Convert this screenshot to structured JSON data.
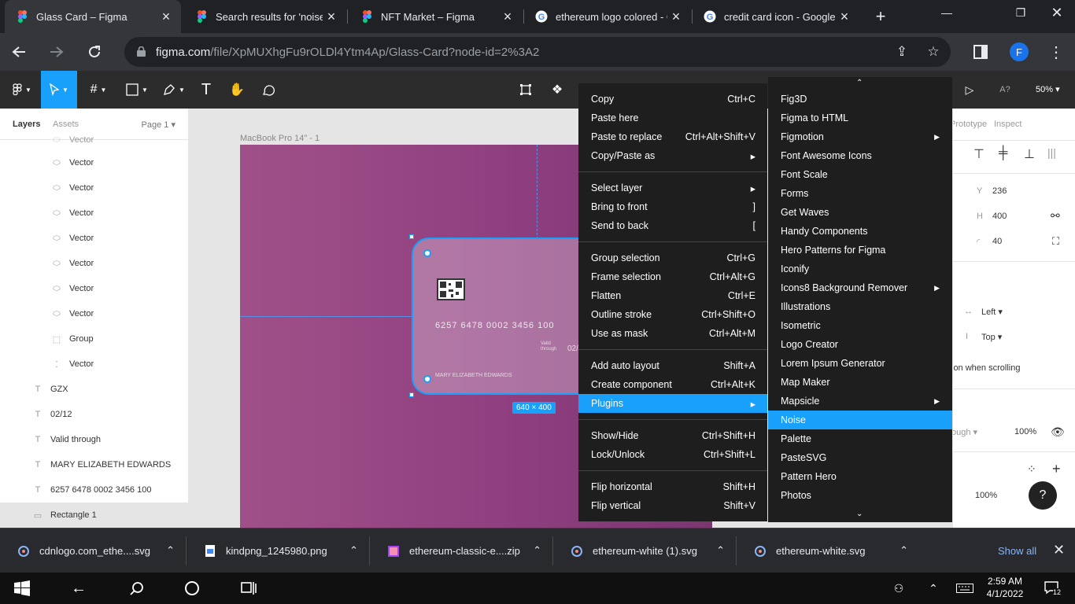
{
  "browser": {
    "tabs": [
      {
        "title": "Glass Card – Figma",
        "favicon": "figma-icon",
        "active": true
      },
      {
        "title": "Search results for 'noise' –",
        "favicon": "figma-icon",
        "active": false
      },
      {
        "title": "NFT Market – Figma",
        "favicon": "figma-icon",
        "active": false
      },
      {
        "title": "ethereum logo colored - G",
        "favicon": "google-icon",
        "active": false
      },
      {
        "title": "credit card icon - Google S",
        "favicon": "google-icon",
        "active": false
      }
    ],
    "url_host": "figma.com",
    "url_path": "/file/XpMUXhgFu9rOLDl4Ytm4Ap/Glass-Card?node-id=2%3A2",
    "profile_initial": "F"
  },
  "figma": {
    "zoom": "50%",
    "left_panel": {
      "tab_layers": "Layers",
      "tab_assets": "Assets",
      "page": "Page 1",
      "layers": [
        {
          "name": "Vector",
          "icon": "vector-icon",
          "indent": 2
        },
        {
          "name": "Vector",
          "icon": "vector-icon",
          "indent": 2
        },
        {
          "name": "Vector",
          "icon": "vector-icon",
          "indent": 2
        },
        {
          "name": "Vector",
          "icon": "vector-icon",
          "indent": 2
        },
        {
          "name": "Vector",
          "icon": "vector-icon",
          "indent": 2
        },
        {
          "name": "Vector",
          "icon": "vector-icon",
          "indent": 2
        },
        {
          "name": "Vector",
          "icon": "vector-icon",
          "indent": 2
        },
        {
          "name": "Vector",
          "icon": "vector-icon",
          "indent": 2
        },
        {
          "name": "Group",
          "icon": "group-icon",
          "indent": 2
        },
        {
          "name": "Vector",
          "icon": "vector-icon",
          "indent": 2
        },
        {
          "name": "GZX",
          "icon": "text-icon",
          "indent": 1
        },
        {
          "name": "02/12",
          "icon": "text-icon",
          "indent": 1
        },
        {
          "name": "Valid through",
          "icon": "text-icon",
          "indent": 1
        },
        {
          "name": "MARY ELIZABETH EDWARDS",
          "icon": "text-icon",
          "indent": 1
        },
        {
          "name": "6257 6478 0002 3456 100",
          "icon": "text-icon",
          "indent": 1
        },
        {
          "name": "Rectangle 1",
          "icon": "rectangle-icon",
          "indent": 1,
          "selected": true
        }
      ]
    },
    "canvas": {
      "frame_label": "MacBook Pro 14\" - 1",
      "card_number": "6257 6478 0002 3456 100",
      "card_name": "MARY ELIZABETH EDWARDS",
      "card_valid": "Valid through",
      "card_date": "02/",
      "dimensions": "640 × 400"
    },
    "right_panel": {
      "tab_prototype": "Prototype",
      "tab_inspect": "Inspect",
      "y_value": "236",
      "h_value": "400",
      "radius_value": "40",
      "constraint_h": "Left",
      "constraint_v": "Top",
      "scroll_text": "ion when scrolling",
      "blend": "ough",
      "opacity": "100%",
      "fill_opacity": "100%"
    },
    "context_menu": {
      "items": [
        {
          "label": "Copy",
          "shortcut": "Ctrl+C"
        },
        {
          "label": "Paste here",
          "shortcut": ""
        },
        {
          "label": "Paste to replace",
          "shortcut": "Ctrl+Alt+Shift+V"
        },
        {
          "label": "Copy/Paste as",
          "shortcut": "▸"
        },
        {
          "label": "Select layer",
          "shortcut": "▸"
        },
        {
          "label": "Bring to front",
          "shortcut": "]"
        },
        {
          "label": "Send to back",
          "shortcut": "["
        },
        {
          "label": "Group selection",
          "shortcut": "Ctrl+G"
        },
        {
          "label": "Frame selection",
          "shortcut": "Ctrl+Alt+G"
        },
        {
          "label": "Flatten",
          "shortcut": "Ctrl+E"
        },
        {
          "label": "Outline stroke",
          "shortcut": "Ctrl+Shift+O"
        },
        {
          "label": "Use as mask",
          "shortcut": "Ctrl+Alt+M"
        },
        {
          "label": "Add auto layout",
          "shortcut": "Shift+A"
        },
        {
          "label": "Create component",
          "shortcut": "Ctrl+Alt+K"
        },
        {
          "label": "Plugins",
          "shortcut": "▸"
        },
        {
          "label": "Show/Hide",
          "shortcut": "Ctrl+Shift+H"
        },
        {
          "label": "Lock/Unlock",
          "shortcut": "Ctrl+Shift+L"
        },
        {
          "label": "Flip horizontal",
          "shortcut": "Shift+H"
        },
        {
          "label": "Flip vertical",
          "shortcut": "Shift+V"
        }
      ]
    },
    "plugins_menu": {
      "items": [
        {
          "label": "Fig3D",
          "arrow": ""
        },
        {
          "label": "Figma to HTML",
          "arrow": ""
        },
        {
          "label": "Figmotion",
          "arrow": "▶"
        },
        {
          "label": "Font Awesome Icons",
          "arrow": ""
        },
        {
          "label": "Font Scale",
          "arrow": ""
        },
        {
          "label": "Forms",
          "arrow": ""
        },
        {
          "label": "Get Waves",
          "arrow": ""
        },
        {
          "label": "Handy Components",
          "arrow": ""
        },
        {
          "label": "Hero Patterns for Figma",
          "arrow": ""
        },
        {
          "label": "Iconify",
          "arrow": ""
        },
        {
          "label": "Icons8 Background Remover",
          "arrow": "▶"
        },
        {
          "label": "Illustrations",
          "arrow": ""
        },
        {
          "label": "Isometric",
          "arrow": ""
        },
        {
          "label": "Logo Creator",
          "arrow": ""
        },
        {
          "label": "Lorem Ipsum Generator",
          "arrow": ""
        },
        {
          "label": "Map Maker",
          "arrow": ""
        },
        {
          "label": "Mapsicle",
          "arrow": "▶"
        },
        {
          "label": "Noise",
          "arrow": ""
        },
        {
          "label": "Palette",
          "arrow": ""
        },
        {
          "label": "PasteSVG",
          "arrow": ""
        },
        {
          "label": "Pattern Hero",
          "arrow": ""
        },
        {
          "label": "Photos",
          "arrow": ""
        }
      ]
    }
  },
  "downloads": {
    "items": [
      {
        "name": "cdnlogo.com_ethe....svg",
        "icon": "svg-file-icon"
      },
      {
        "name": "kindpng_1245980.png",
        "icon": "png-file-icon"
      },
      {
        "name": "ethereum-classic-e....zip",
        "icon": "zip-file-icon"
      },
      {
        "name": "ethereum-white (1).svg",
        "icon": "svg-file-icon"
      },
      {
        "name": "ethereum-white.svg",
        "icon": "svg-file-icon"
      }
    ],
    "show_all": "Show all"
  },
  "taskbar": {
    "time": "2:59 AM",
    "date": "4/1/2022",
    "notifications": "12"
  },
  "colors": {
    "figma_blue": "#18a0fb",
    "frame_purple": "#903f80",
    "menu_bg": "#1e1e1e"
  }
}
